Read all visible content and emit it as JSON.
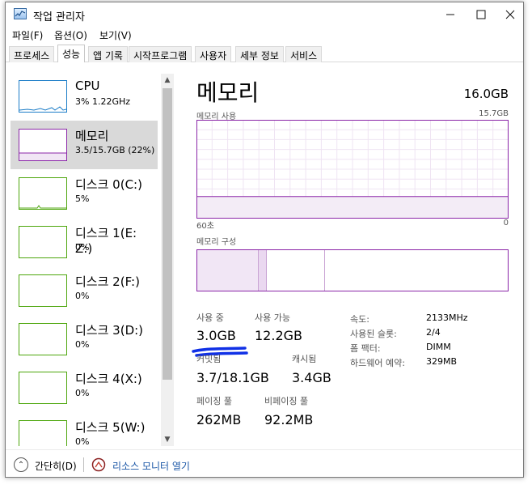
{
  "window": {
    "title": "작업 관리자"
  },
  "menu": [
    "파일(F)",
    "옵션(O)",
    "보기(V)"
  ],
  "tabs": [
    "프로세스",
    "성능",
    "앱 기록",
    "시작프로그램",
    "사용자",
    "세부 정보",
    "서비스"
  ],
  "active_tab": 1,
  "sidebar": [
    {
      "name": "CPU",
      "sub": "3% 1.22GHz",
      "color": "#1a7cc7"
    },
    {
      "name": "메모리",
      "sub": "3.5/15.7GB (22%)",
      "color": "#8b26a8"
    },
    {
      "name": "디스크 0(C:)",
      "sub": "5%",
      "color": "#4da60c"
    },
    {
      "name": "디스크 1(E: Z:)",
      "sub": "0%",
      "color": "#4da60c"
    },
    {
      "name": "디스크 2(F:)",
      "sub": "0%",
      "color": "#4da60c"
    },
    {
      "name": "디스크 3(D:)",
      "sub": "0%",
      "color": "#4da60c"
    },
    {
      "name": "디스크 4(X:)",
      "sub": "0%",
      "color": "#4da60c"
    },
    {
      "name": "디스크 5(W:)",
      "sub": "0%",
      "color": "#4da60c"
    }
  ],
  "selected_item": 1,
  "main": {
    "title": "메모리",
    "total": "16.0GB",
    "usage_label": "메모리 사용",
    "usage_max": "15.7GB",
    "axis_left": "60초",
    "axis_right": "0",
    "composition_label": "메모리 구성",
    "accent_color": "#8b26a8"
  },
  "stats": {
    "in_use_label": "사용 중",
    "in_use": "3.0GB",
    "available_label": "사용 가능",
    "available": "12.2GB",
    "committed_label": "커밋됨",
    "committed": "3.7/18.1GB",
    "cached_label": "캐시됨",
    "cached": "3.4GB",
    "paged_label": "페이징 풀",
    "paged": "262MB",
    "nonpaged_label": "비페이징 풀",
    "nonpaged": "92.2MB"
  },
  "props": [
    {
      "label": "속도:",
      "value": "2133MHz"
    },
    {
      "label": "사용된 슬롯:",
      "value": "2/4"
    },
    {
      "label": "폼 팩터:",
      "value": "DIMM"
    },
    {
      "label": "하드웨어 예약:",
      "value": "329MB"
    }
  ],
  "footer": {
    "collapse": "간단히(D)",
    "resmon": "리소스 모니터 열기"
  },
  "chart_data": {
    "type": "area",
    "title": "메모리 사용",
    "x": [
      60,
      0
    ],
    "series": [
      {
        "values": [
          3.5,
          3.5
        ]
      }
    ],
    "ylim": [
      0,
      15.7
    ],
    "xlabel": "",
    "ylabel": ""
  }
}
